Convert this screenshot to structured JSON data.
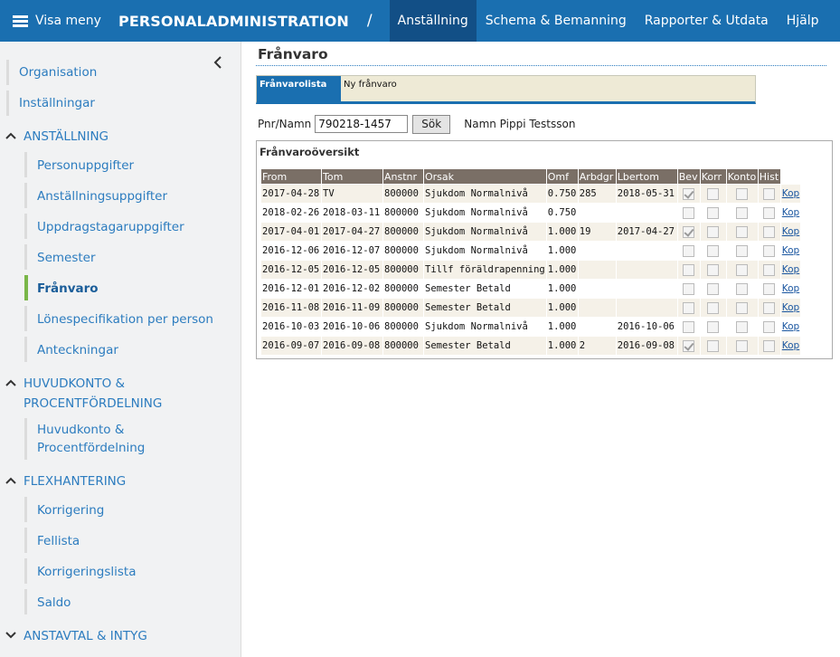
{
  "topbar": {
    "menu_label": "Visa meny",
    "app_title": "PERSONALADMINISTRATION",
    "separator": "/",
    "nav": [
      "Anställning",
      "Schema & Bemanning",
      "Rapporter & Utdata",
      "Hjälp"
    ]
  },
  "sidebar": {
    "top_links": [
      "Organisation",
      "Inställningar"
    ],
    "sections": [
      {
        "title": "ANSTÄLLNING",
        "items": [
          "Personuppgifter",
          "Anställningsuppgifter",
          "Uppdragstagaruppgifter",
          "Semester",
          "Frånvaro",
          "Lönespecifikation per person",
          "Anteckningar"
        ]
      },
      {
        "title_line1": "HUVUDKONTO &",
        "title_line2": "PROCENTFÖRDELNING",
        "item_line1": "Huvudkonto &",
        "item_line2": "Procentfördelning"
      },
      {
        "title": "FLEXHANTERING",
        "items": [
          "Korrigering",
          "Fellista",
          "Korrigeringslista",
          "Saldo"
        ]
      },
      {
        "title": "ANSTAVTAL & INTYG"
      }
    ]
  },
  "main": {
    "page_title": "Frånvaro",
    "tabs": [
      "Frånvarolista",
      "Ny frånvaro"
    ],
    "search": {
      "label": "Pnr/Namn",
      "value": "790218-1457",
      "button": "Sök",
      "name_text": "Namn Pippi Testsson"
    },
    "panel_title": "Frånvaroöversikt",
    "columns": [
      "From",
      "Tom",
      "Anstnr",
      "Orsak",
      "Omf",
      "Arbdgr",
      "Lbertom",
      "Bev",
      "Korr",
      "Konto",
      "Hist"
    ],
    "rows": [
      {
        "from": "2017-04-28",
        "tom": "TV",
        "anstnr": "800000",
        "orsak": "Sjukdom Normalnivå",
        "omf": "0.750",
        "arbdgr": "285",
        "lbertom": "2018-05-31",
        "bev": true,
        "link": "Kop"
      },
      {
        "from": "2018-02-26",
        "tom": "2018-03-11",
        "anstnr": "800000",
        "orsak": "Sjukdom Normalnivå",
        "omf": "0.750",
        "arbdgr": "",
        "lbertom": "",
        "bev": false,
        "link": "Kop"
      },
      {
        "from": "2017-04-01",
        "tom": "2017-04-27",
        "anstnr": "800000",
        "orsak": "Sjukdom Normalnivå",
        "omf": "1.000",
        "arbdgr": "19",
        "lbertom": "2017-04-27",
        "bev": true,
        "link": "Kop"
      },
      {
        "from": "2016-12-06",
        "tom": "2016-12-07",
        "anstnr": "800000",
        "orsak": "Sjukdom Normalnivå",
        "omf": "1.000",
        "arbdgr": "",
        "lbertom": "",
        "bev": false,
        "link": "Kop"
      },
      {
        "from": "2016-12-05",
        "tom": "2016-12-05",
        "anstnr": "800000",
        "orsak": "Tillf föräldrapenning",
        "omf": "1.000",
        "arbdgr": "",
        "lbertom": "",
        "bev": false,
        "link": "Kop"
      },
      {
        "from": "2016-12-01",
        "tom": "2016-12-02",
        "anstnr": "800000",
        "orsak": "Semester Betald",
        "omf": "1.000",
        "arbdgr": "",
        "lbertom": "",
        "bev": false,
        "link": "Kop"
      },
      {
        "from": "2016-11-08",
        "tom": "2016-11-09",
        "anstnr": "800000",
        "orsak": "Semester Betald",
        "omf": "1.000",
        "arbdgr": "",
        "lbertom": "",
        "bev": false,
        "link": "Kop"
      },
      {
        "from": "2016-10-03",
        "tom": "2016-10-06",
        "anstnr": "800000",
        "orsak": "Sjukdom Normalnivå",
        "omf": "1.000",
        "arbdgr": "",
        "lbertom": "2016-10-06",
        "bev": false,
        "link": "Kop"
      },
      {
        "from": "2016-09-07",
        "tom": "2016-09-08",
        "anstnr": "800000",
        "orsak": "Semester Betald",
        "omf": "1.000",
        "arbdgr": "2",
        "lbertom": "2016-09-08",
        "bev": true,
        "link": "Kop"
      }
    ]
  }
}
